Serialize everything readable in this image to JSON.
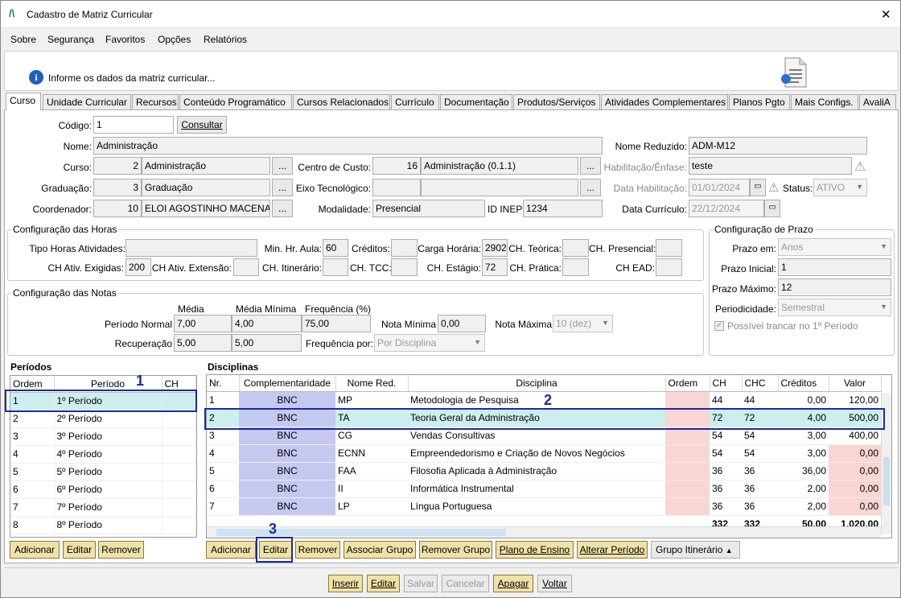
{
  "window": {
    "title": "Cadastro de Matriz Curricular",
    "close_glyph": "✕",
    "app_glyph": "/\\"
  },
  "menu": [
    "Sobre",
    "Segurança",
    "Favoritos",
    "Opções",
    "Relatórios"
  ],
  "info": {
    "text": "Informe os dados da matriz curricular...",
    "icon_glyph": "i"
  },
  "tabs": [
    "Curso",
    "Unidade Curricular",
    "Recursos",
    "Conteúdo Programático",
    "Cursos Relacionados",
    "Currículo",
    "Documentação",
    "Produtos/Serviços",
    "Atividades Complementares",
    "Planos Pgto",
    "Mais Configs.",
    "AvaliA"
  ],
  "form": {
    "codigo_label": "Código:",
    "codigo": "1",
    "consultar": "Consultar",
    "nome_label": "Nome:",
    "nome": "Administração",
    "nome_reduzido_label": "Nome Reduzido:",
    "nome_reduzido": "ADM-M12",
    "curso_label": "Curso:",
    "curso_code": "2",
    "curso_name": "Administração",
    "centro_label": "Centro de Custo:",
    "centro_code": "16",
    "centro_name": "Administração (0.1.1)",
    "habilitacao_label": "Habilitação/Ênfase:",
    "habilitacao": "teste",
    "graduacao_label": "Graduação:",
    "graduacao_code": "3",
    "graduacao_name": "Graduação",
    "eixo_label": "Eixo Tecnológico:",
    "data_hab_label": "Data Habilitação:",
    "data_hab": "01/01/2024",
    "status_label": "Status:",
    "status": "ATIVO",
    "coordenador_label": "Coordenador:",
    "coord_code": "10",
    "coord_name": "ELOI AGOSTINHO MACENA",
    "modalidade_label": "Modalidade:",
    "modalidade": "Presencial",
    "inep_label": "ID INEP:",
    "inep": "1234",
    "data_curr_label": "Data Currículo:",
    "data_curr": "22/12/2024",
    "dots": "..."
  },
  "horas": {
    "title": "Configuração das Horas",
    "tipo_label": "Tipo Horas Atividades:",
    "min_hr_label": "Min. Hr. Aula:",
    "min_hr": "60",
    "creditos_label": "Créditos:",
    "carga_label": "Carga Horária:",
    "carga": "2902",
    "ch_teorica_label": "CH. Teórica:",
    "ch_presencial_label": "CH. Presencial:",
    "ch_ativ_label": "CH Ativ. Exigidas:",
    "ch_ativ": "200",
    "ch_ext_label": "CH Ativ. Extensão:",
    "ch_itin_label": "CH. Itinerário:",
    "ch_tcc_label": "CH. TCC:",
    "ch_estagio_label": "CH. Estágio:",
    "ch_estagio": "72",
    "ch_pratica_label": "CH. Prática:",
    "ch_ead_label": "CH EAD:"
  },
  "notas": {
    "title": "Configuração das Notas",
    "media_h": "Média",
    "media_min_h": "Média Mínima",
    "freq_h": "Frequência (%)",
    "periodo_normal_label": "Período Normal",
    "pn_media": "7,00",
    "pn_media_min": "4,00",
    "pn_freq": "75,00",
    "nota_min_label": "Nota Mínima",
    "nota_min": "0,00",
    "nota_max_label": "Nota Máxima",
    "nota_max": "10 (dez)",
    "recuperacao_label": "Recuperação",
    "rec_media": "5,00",
    "rec_media_min": "5,00",
    "freq_por_label": "Frequência por:",
    "freq_por": "Por Disciplina"
  },
  "prazo": {
    "title": "Configuração de Prazo",
    "prazo_em_label": "Prazo em:",
    "prazo_em": "Anos",
    "prazo_ini_label": "Prazo Inicial:",
    "prazo_ini": "1",
    "prazo_max_label": "Prazo Máximo:",
    "prazo_max": "12",
    "periodicidade_label": "Periodicidade:",
    "periodicidade": "Semestral",
    "trancar_label": "Possível trancar no 1º Período"
  },
  "periodos": {
    "title": "Períodos",
    "headers": [
      "Ordem",
      "Período",
      "CH"
    ],
    "rows": [
      [
        "1",
        "1º Período",
        ""
      ],
      [
        "2",
        "2º Período",
        ""
      ],
      [
        "3",
        "3º Período",
        ""
      ],
      [
        "4",
        "4º Período",
        ""
      ],
      [
        "5",
        "5º Período",
        ""
      ],
      [
        "6",
        "6º Período",
        ""
      ],
      [
        "7",
        "7º Período",
        ""
      ],
      [
        "8",
        "8º Período",
        ""
      ]
    ],
    "buttons": [
      "Adicionar",
      "Editar",
      "Remover"
    ]
  },
  "disciplinas": {
    "title": "Disciplinas",
    "headers": [
      "Nr.",
      "Complementaridade",
      "Nome Red.",
      "Disciplina",
      "Ordem",
      "CH",
      "CHC",
      "Créditos",
      "Valor"
    ],
    "rows": [
      [
        "1",
        "BNC",
        "MP",
        "Metodologia de Pesquisa",
        "",
        "44",
        "44",
        "0,00",
        "120,00"
      ],
      [
        "2",
        "BNC",
        "TA",
        "Teoria Geral da Administração",
        "",
        "72",
        "72",
        "4,00",
        "500,00"
      ],
      [
        "3",
        "BNC",
        "CG",
        "Vendas Consultivas",
        "",
        "54",
        "54",
        "3,00",
        "400,00"
      ],
      [
        "4",
        "BNC",
        "ECNN",
        "Empreendedorismo e Criação de Novos Negócios",
        "",
        "54",
        "54",
        "3,00",
        "0,00"
      ],
      [
        "5",
        "BNC",
        "FAA",
        "Filosofia Aplicada à Administração",
        "",
        "36",
        "36",
        "36,00",
        "0,00"
      ],
      [
        "6",
        "BNC",
        "II",
        "Informática Instrumental",
        "",
        "36",
        "36",
        "2,00",
        "0,00"
      ],
      [
        "7",
        "BNC",
        "LP",
        "Língua Portuguesa",
        "",
        "36",
        "36",
        "2,00",
        "0,00"
      ]
    ],
    "totals": [
      "332",
      "332",
      "50,00",
      "1.020,00"
    ],
    "buttons": [
      "Adicionar",
      "Editar",
      "Remover",
      "Associar Grupo",
      "Remover Grupo",
      "Plano de Ensino",
      "Alterar Período",
      "Grupo Itinerário"
    ]
  },
  "annotations": [
    "1",
    "2",
    "3"
  ],
  "footer": [
    "Inserir",
    "Editar",
    "Salvar",
    "Cancelar",
    "Apagar",
    "Voltar"
  ],
  "colors": {
    "accent_box": "#1c2aa0",
    "selected_row": "#cdeeee",
    "bnc_cell": "#c5c8ef",
    "pink_cell": "#f8d6d2",
    "gold_button": "#efe2a8"
  }
}
